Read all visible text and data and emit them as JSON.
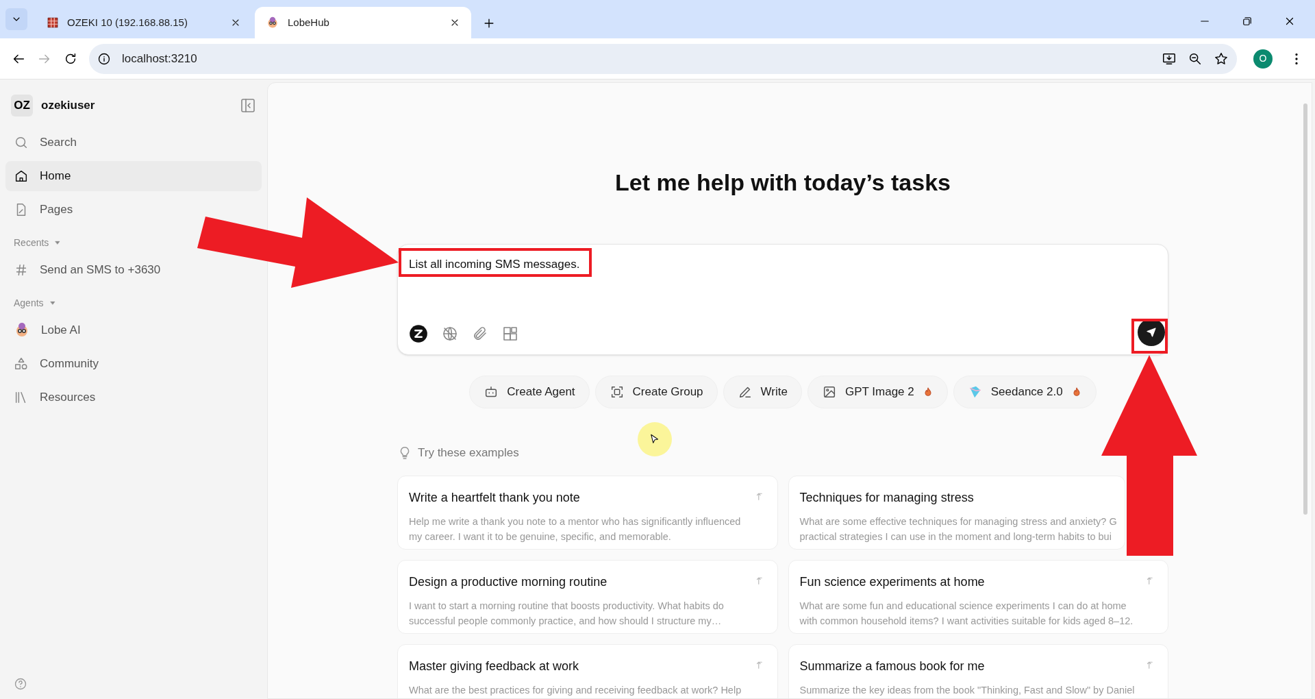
{
  "browser": {
    "tabs": [
      {
        "title": "OZEKI 10 (192.168.88.15)",
        "kind": "grid",
        "selected": false
      },
      {
        "title": "LobeHub",
        "kind": "avatar",
        "selected": true
      }
    ],
    "address": "localhost:3210",
    "profile_initial": "O"
  },
  "sidebar": {
    "user_initials": "OZ",
    "user_name": "ozekiuser",
    "nav": [
      {
        "label": "Search",
        "kind": "search",
        "selected": false
      },
      {
        "label": "Home",
        "kind": "home",
        "selected": true
      },
      {
        "label": "Pages",
        "kind": "pages",
        "selected": false
      }
    ],
    "sections": [
      {
        "title": "Recents",
        "items": [
          {
            "label": "Send an SMS to +3630",
            "kind": "hash"
          }
        ]
      },
      {
        "title": "Agents",
        "items": [
          {
            "label": "Lobe AI",
            "kind": "avatar"
          },
          {
            "label": "Community",
            "kind": "shapes"
          },
          {
            "label": "Resources",
            "kind": "books"
          }
        ]
      }
    ]
  },
  "main": {
    "heading": "Let me help with today’s tasks",
    "input": {
      "value": "List all incoming SMS messages."
    },
    "chips": [
      {
        "label": "Create Agent",
        "kind": "robot",
        "hot": false
      },
      {
        "label": "Create Group",
        "kind": "group",
        "hot": false
      },
      {
        "label": "Write",
        "kind": "pen",
        "hot": false
      },
      {
        "label": "GPT Image 2",
        "kind": "image",
        "hot": true
      },
      {
        "label": "Seedance 2.0",
        "kind": "seedance",
        "hot": true
      }
    ],
    "examples_title": "Try these examples",
    "examples": [
      {
        "title": "Write a heartfelt thank you note",
        "lines": [
          "Help me write a thank you note to a mentor who has significantly influenced",
          "my career. I want it to be genuine, specific, and memorable."
        ],
        "arrow": true
      },
      {
        "title": "Techniques for managing stress",
        "lines": [
          "What are some effective techniques for managing stress and anxiety? G",
          "practical strategies I can use in the moment and long-term habits to bui"
        ],
        "arrow": false
      },
      {
        "title": "Design a productive morning routine",
        "lines": [
          "I want to start a morning routine that boosts productivity. What habits do",
          "successful people commonly practice, and how should I structure my…"
        ],
        "arrow": true
      },
      {
        "title": "Fun science experiments at home",
        "lines": [
          "What are some fun and educational science experiments I can do at home",
          "with common household items? I want activities suitable for kids aged 8–12."
        ],
        "arrow": true
      },
      {
        "title": "Master giving feedback at work",
        "lines": [
          "What are the best practices for giving and receiving feedback at work? Help"
        ],
        "arrow": true
      },
      {
        "title": "Summarize a famous book for me",
        "lines": [
          "Summarize the key ideas from the book \"Thinking, Fast and Slow\" by Daniel"
        ],
        "arrow": true
      }
    ]
  }
}
